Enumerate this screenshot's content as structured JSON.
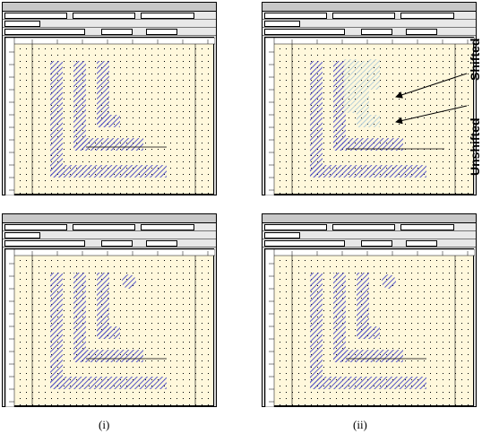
{
  "captions": {
    "left": "(i)",
    "right": "(ii)"
  },
  "annotations": {
    "shifted": "Shifted",
    "unshifted": "Unshifted"
  },
  "panels": [
    {
      "id": "top-left"
    },
    {
      "id": "top-right"
    },
    {
      "id": "bottom-left"
    },
    {
      "id": "bottom-right"
    }
  ],
  "colors": {
    "window_bg": "#d9d9d9",
    "canvas_bg": "#fff8dc",
    "hatch": "#5a5ac8",
    "hatch_light": "#b8d0d8",
    "grid_dot": "#000000"
  }
}
